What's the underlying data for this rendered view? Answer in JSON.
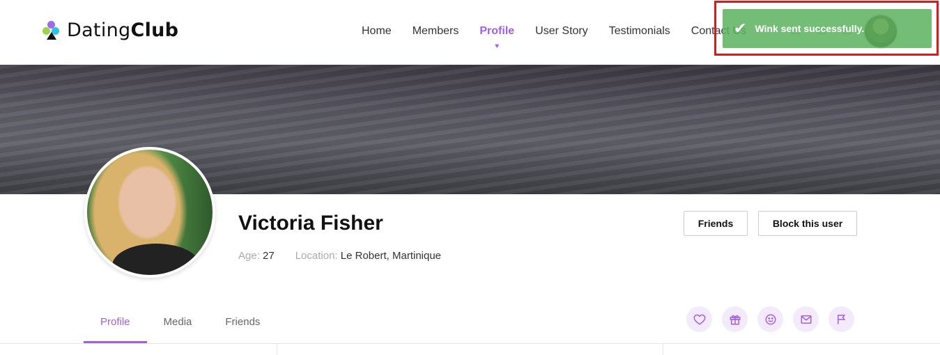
{
  "header": {
    "logo_light": "Dating",
    "logo_bold": "Club",
    "nav": [
      {
        "label": "Home"
      },
      {
        "label": "Members"
      },
      {
        "label": "Profile",
        "active": true
      },
      {
        "label": "User Story"
      },
      {
        "label": "Testimonials"
      },
      {
        "label": "Contact Us"
      }
    ]
  },
  "toast": {
    "message": "Wink sent successfully.",
    "color": "#5cb25e"
  },
  "profile": {
    "name": "Victoria Fisher",
    "age_label": "Age:",
    "age": "27",
    "location_label": "Location:",
    "location": "Le Robert, Martinique",
    "buttons": {
      "friends": "Friends",
      "block": "Block this user"
    }
  },
  "tabs": [
    {
      "label": "Profile",
      "active": true
    },
    {
      "label": "Media"
    },
    {
      "label": "Friends"
    }
  ],
  "actions": [
    "heart-icon",
    "gift-icon",
    "smile-icon",
    "mail-icon",
    "flag-icon"
  ],
  "colors": {
    "accent": "#a25fe0",
    "toast_border": "#e01717"
  }
}
